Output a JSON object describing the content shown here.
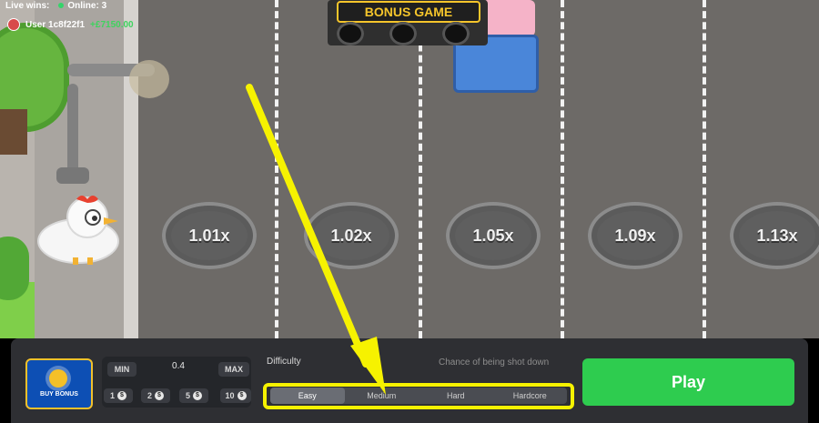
{
  "hud": {
    "live_wins_label": "Live wins:",
    "online_label": "Online:",
    "online_count": "3",
    "user_name": "User 1c8f22f1",
    "user_win": "+£7150.00"
  },
  "scene": {
    "sign_text": "BONUS GAME"
  },
  "multipliers": [
    "1.01x",
    "1.02x",
    "1.05x",
    "1.09x",
    "1.13x"
  ],
  "controls": {
    "buy_bonus_label": "BUY BONUS",
    "min_label": "MIN",
    "bet_value": "0.4",
    "max_label": "MAX",
    "quick_bets": [
      "1",
      "2",
      "5",
      "10"
    ],
    "difficulty_label": "Difficulty",
    "chance_label": "Chance of being shot down",
    "difficulties": [
      "Easy",
      "Medium",
      "Hard",
      "Hardcore"
    ],
    "active_difficulty": "Easy",
    "play_label": "Play"
  },
  "colors": {
    "annotation": "#f6f200",
    "play_button": "#2ecc4f"
  }
}
